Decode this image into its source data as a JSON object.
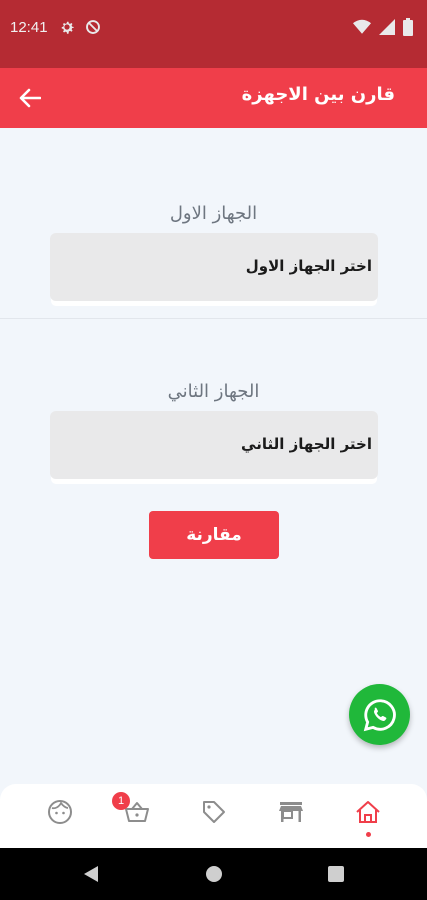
{
  "status_bar": {
    "time": "12:41"
  },
  "app_bar": {
    "title": "قارن بين الاجهزة"
  },
  "first_device": {
    "label": "الجهاز الاول",
    "placeholder": "اختر الجهاز الاول"
  },
  "second_device": {
    "label": "الجهاز الثاني",
    "placeholder": "اختر الجهاز الثاني"
  },
  "compare_button": {
    "label": "مقارنة"
  },
  "bottom_nav": {
    "items": [
      "profile",
      "cart",
      "offers",
      "stores",
      "home"
    ],
    "active": "home",
    "cart_badge": "1"
  },
  "colors": {
    "primary": "#f03e4a",
    "status_bar": "#b52b33",
    "whatsapp": "#20b83a",
    "background": "#f2f6fb"
  },
  "icons": [
    "gear-icon",
    "no-sync-icon",
    "wifi-icon",
    "signal-icon",
    "battery-icon",
    "back-arrow-icon",
    "whatsapp-icon",
    "face-icon",
    "basket-icon",
    "tag-icon",
    "store-icon",
    "home-icon"
  ]
}
